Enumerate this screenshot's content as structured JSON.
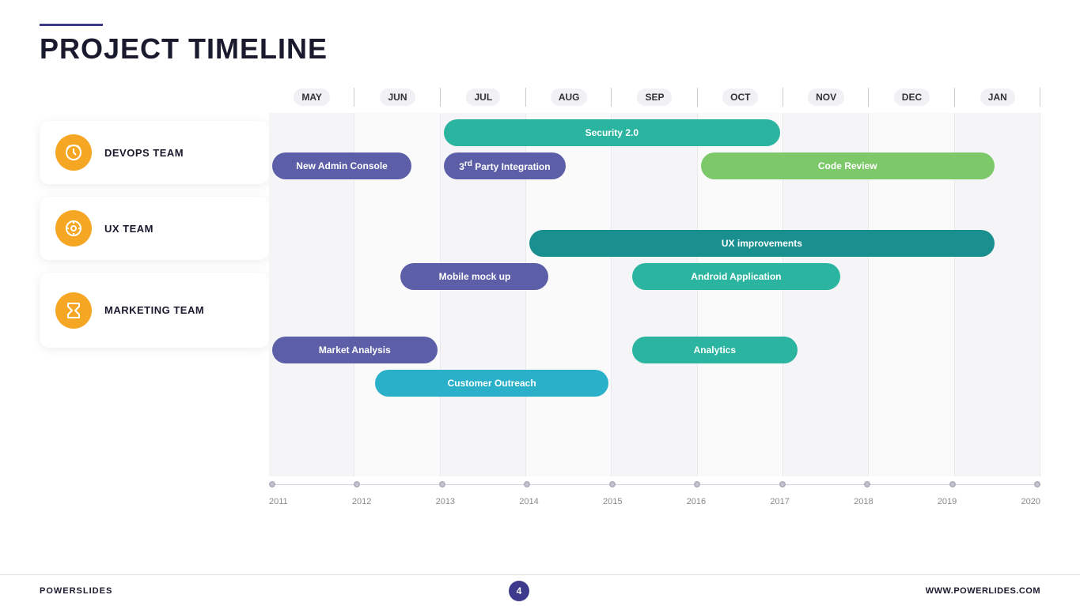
{
  "header": {
    "title": "PROJECT TIMELINE"
  },
  "teams": [
    {
      "id": "devops",
      "name": "DEVOPS TEAM",
      "icon": "clock-icon"
    },
    {
      "id": "ux",
      "name": "UX TEAM",
      "icon": "compass-icon"
    },
    {
      "id": "marketing",
      "name": "MARKETING TEAM",
      "icon": "hourglass-icon"
    }
  ],
  "months": [
    "MAY",
    "JUN",
    "JUL",
    "AUG",
    "SEP",
    "OCT",
    "NOV",
    "DEC",
    "JAN"
  ],
  "years": [
    "2011",
    "2012",
    "2013",
    "2014",
    "2015",
    "2016",
    "2017",
    "2018",
    "2019",
    "2020"
  ],
  "bars": {
    "devops": [
      {
        "label": "Security 2.0",
        "color": "bar-teal",
        "row": 1
      },
      {
        "label": "New Admin Console",
        "color": "bar-purple",
        "row": 2
      },
      {
        "label": "3rd Party Integration",
        "color": "bar-purple",
        "row": 2
      },
      {
        "label": "Code Review",
        "color": "bar-light-green",
        "row": 2
      }
    ],
    "ux": [
      {
        "label": "UX improvements",
        "color": "bar-dark-teal",
        "row": 1
      },
      {
        "label": "Mobile mock up",
        "color": "bar-purple",
        "row": 2
      },
      {
        "label": "Android Application",
        "color": "bar-teal",
        "row": 2
      }
    ],
    "marketing": [
      {
        "label": "Market Analysis",
        "color": "bar-purple",
        "row": 1
      },
      {
        "label": "Analytics",
        "color": "bar-teal",
        "row": 1
      },
      {
        "label": "Customer Outreach",
        "color": "bar-cyan",
        "row": 2
      }
    ]
  },
  "footer": {
    "left": "POWERSLIDES",
    "page": "4",
    "right": "WWW.POWERLIDES.COM"
  }
}
